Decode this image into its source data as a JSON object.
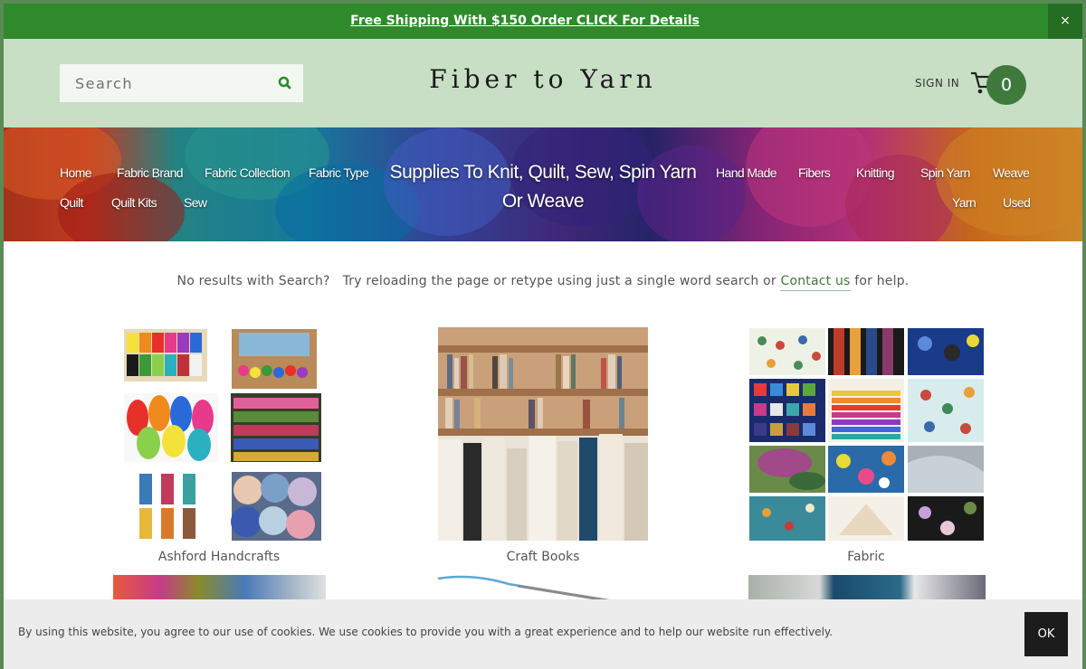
{
  "announcement": {
    "text": "Free Shipping With $150 Order CLICK For Details",
    "close": "×"
  },
  "header": {
    "search_placeholder": "Search",
    "logo": "Fiber to Yarn",
    "sign_in": "SIGN IN",
    "cart_count": "0"
  },
  "hero": {
    "title": "Supplies To Knit, Quilt, Sew, Spin Yarn Or Weave",
    "nav_left": [
      "Home",
      "Fabric Brand",
      "Fabric Collection",
      "Fabric Type",
      "Quilt",
      "Quilt Kits",
      "Sew"
    ],
    "nav_right": [
      "Hand Made",
      "Fibers",
      "Knitting",
      "Spin Yarn",
      "Weave",
      "Yarn",
      "Used"
    ]
  },
  "notice": {
    "before": "No results with Search?   Try reloading the page or retype using just a single word search or ",
    "link": "Contact us",
    "after": " for help."
  },
  "categories": [
    {
      "label": "Ashford Handcrafts",
      "icon": "yarn-supplies-image"
    },
    {
      "label": "Craft Books",
      "icon": "bookshelf-image"
    },
    {
      "label": "Fabric",
      "icon": "fabric-collage-image"
    }
  ],
  "cookie": {
    "text": "By using this website, you agree to our use of cookies. We use cookies to provide you with a great experience and to help our website run effectively.",
    "ok": "OK"
  },
  "colors": {
    "brand_green": "#2f8a2c",
    "header_bg": "#c8dfc5",
    "cart_badge": "#3f7a3c",
    "link_green": "#3f7a3c"
  }
}
